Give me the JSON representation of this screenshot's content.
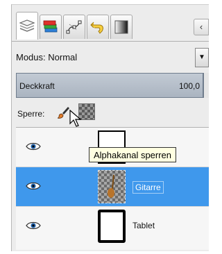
{
  "tabs": [
    {
      "name": "layers",
      "icon": "layers-icon",
      "active": true
    },
    {
      "name": "channels",
      "icon": "channels-icon",
      "active": false
    },
    {
      "name": "paths",
      "icon": "paths-icon",
      "active": false
    },
    {
      "name": "undo-history",
      "icon": "undo-icon",
      "active": false
    },
    {
      "name": "gradients",
      "icon": "gradient-icon",
      "active": false
    }
  ],
  "mode": {
    "label": "Modus: Normal"
  },
  "opacity": {
    "label": "Deckkraft",
    "value": "100,0"
  },
  "lock": {
    "label": "Sperre:",
    "tooltip": "Alphakanal sperren"
  },
  "layers": [
    {
      "name": "",
      "visible": true,
      "selected": false,
      "thumb": "white"
    },
    {
      "name": "Gitarre",
      "visible": true,
      "selected": true,
      "thumb": "checker"
    },
    {
      "name": "Tablet",
      "visible": true,
      "selected": false,
      "thumb": "white"
    }
  ],
  "colors": {
    "selection": "#3f98ec",
    "tooltip_bg": "#ffffe1",
    "opacity_bar": "#b4bdc8"
  }
}
